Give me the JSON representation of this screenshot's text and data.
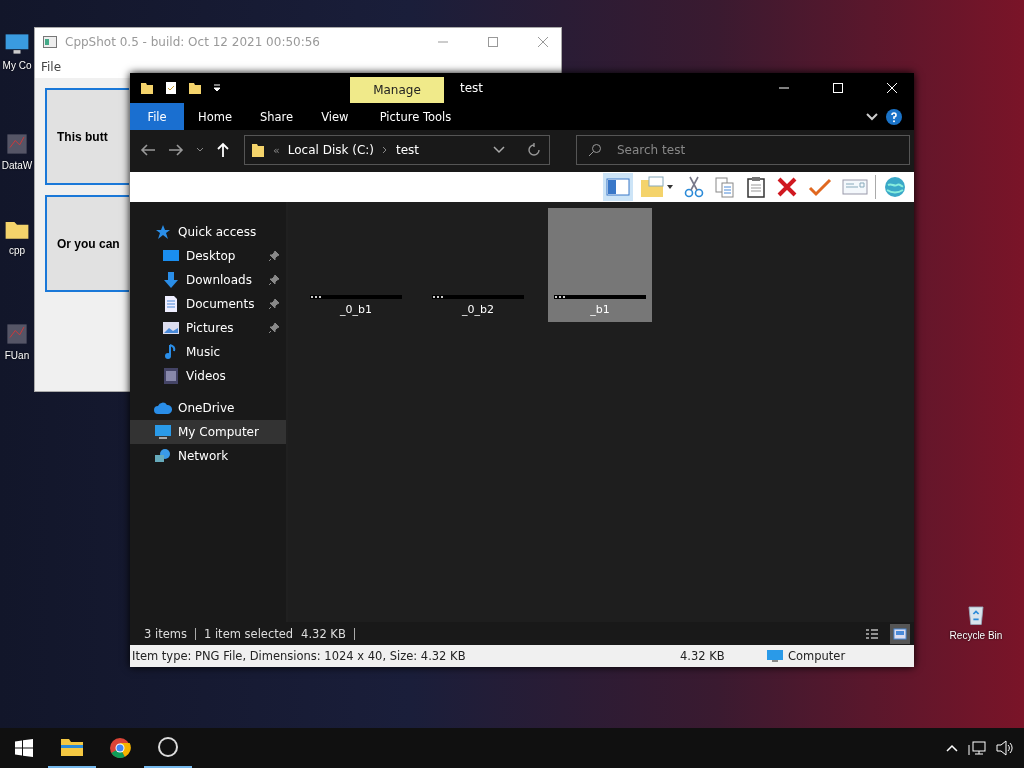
{
  "desktop_icons": [
    {
      "label": "My Co",
      "kind": "computer"
    },
    {
      "label": "DataW",
      "kind": "app"
    },
    {
      "label": "cpp",
      "kind": "folder"
    },
    {
      "label": "FUan",
      "kind": "app"
    },
    {
      "label": "Recycle Bin",
      "kind": "bin"
    }
  ],
  "cppshot": {
    "title": "CppShot 0.5 - build: Oct 12 2021 00:50:56",
    "menu": [
      "File"
    ],
    "buttons": [
      "This butt",
      "Or you can"
    ]
  },
  "explorer": {
    "contextual_tab": "Manage",
    "title": "test",
    "ribbon_tabs": [
      {
        "label": "File",
        "selected": true
      },
      {
        "label": "Home",
        "selected": false
      },
      {
        "label": "Share",
        "selected": false
      },
      {
        "label": "View",
        "selected": false
      },
      {
        "label": "Picture Tools",
        "selected": false
      }
    ],
    "address": {
      "overflow": "«",
      "segments": [
        "Local Disk (C:)",
        "test"
      ]
    },
    "search": {
      "placeholder": "Search test"
    },
    "navigation": [
      {
        "label": "Quick access",
        "kind": "star",
        "selected": false,
        "children": [
          {
            "label": "Desktop",
            "kind": "desktop",
            "pinned": true,
            "selected": false
          },
          {
            "label": "Downloads",
            "kind": "download",
            "pinned": true,
            "selected": false
          },
          {
            "label": "Documents",
            "kind": "document",
            "pinned": true,
            "selected": false
          },
          {
            "label": "Pictures",
            "kind": "picture",
            "pinned": true,
            "selected": false
          },
          {
            "label": "Music",
            "kind": "music",
            "pinned": false,
            "selected": false
          },
          {
            "label": "Videos",
            "kind": "video",
            "pinned": false,
            "selected": false
          }
        ]
      },
      {
        "label": "OneDrive",
        "kind": "cloud",
        "selected": false
      },
      {
        "label": "My Computer",
        "kind": "computer",
        "selected": true
      },
      {
        "label": "Network",
        "kind": "network",
        "selected": false
      }
    ],
    "files": [
      {
        "name": "_0_b1",
        "selected": false
      },
      {
        "name": "_0_b2",
        "selected": false
      },
      {
        "name": "_b1",
        "selected": true
      }
    ],
    "status_bar": {
      "count": "3 items",
      "selection": "1 item selected",
      "size": "4.32 KB"
    },
    "view_buttons": [
      {
        "kind": "details",
        "selected": false
      },
      {
        "kind": "large",
        "selected": true
      }
    ],
    "details_bar": {
      "info": "Item type: PNG File, Dimensions: 1024 x 40, Size: 4.32 KB",
      "size": "4.32 KB",
      "location": "Computer"
    }
  },
  "taskbar": {
    "apps": [
      {
        "kind": "explorer",
        "active": true
      },
      {
        "kind": "chrome",
        "active": false
      },
      {
        "kind": "cppshot",
        "active": true
      }
    ]
  }
}
